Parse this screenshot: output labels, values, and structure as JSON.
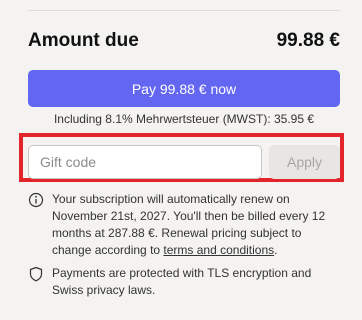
{
  "summary": {
    "label": "Amount due",
    "amount": "99.88 €"
  },
  "pay_button": {
    "label": "Pay 99.88 € now"
  },
  "tax_line": "Including 8.1% Mehrwertsteuer (MWST): 35.95 €",
  "gift_code": {
    "placeholder": "Gift code",
    "value": "",
    "apply_label": "Apply"
  },
  "renewal": {
    "text_before": "Your subscription will automatically renew on November 21st, 2027. You'll then be billed every 12 months at 287.88 €. Renewal pricing subject to change according to ",
    "link_text": "terms and conditions",
    "text_after": "."
  },
  "security": {
    "text": "Payments are protected with TLS encryption and Swiss privacy laws."
  },
  "colors": {
    "accent": "#6366f1",
    "highlight": "#e3242b"
  },
  "icons": {
    "renewal": "info-icon",
    "security": "shield-icon"
  }
}
